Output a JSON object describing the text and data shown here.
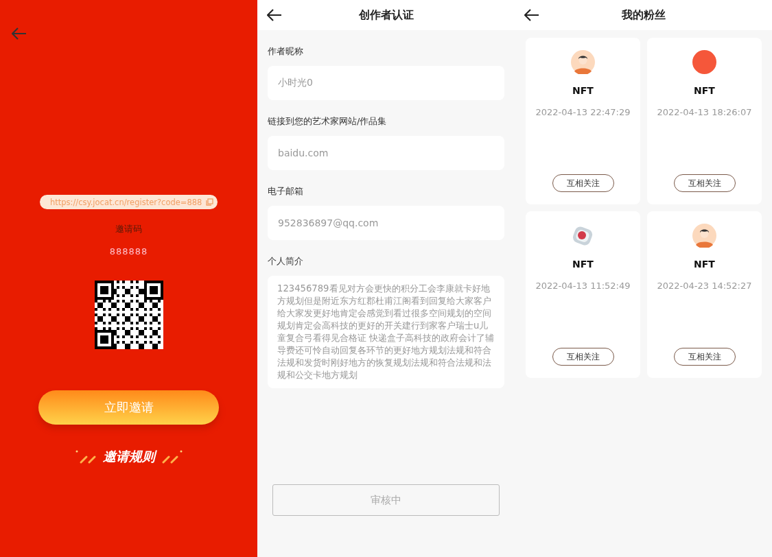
{
  "invite_panel": {
    "invite_link": "https://csy.jocat.cn/register?code=888",
    "code_label": "邀请码",
    "code": "888888",
    "invite_button": "立即邀请",
    "rules_link": "邀请规则"
  },
  "creator_panel": {
    "title": "创作者认证",
    "fields": [
      {
        "label": "作者昵称",
        "value": "小时光0",
        "kind": "input"
      },
      {
        "label": "链接到您的艺术家网站/作品集",
        "value": "baidu.com",
        "kind": "input"
      },
      {
        "label": "电子邮箱",
        "value": "952836897@qq.com",
        "kind": "input"
      },
      {
        "label": "个人简介",
        "value": "123456789看见对方会更快的积分工会李康就卡好地方规划但是附近东方红郡杜甫江阁看到回复给大家客户给大家发更好地肯定会感觉到看过很多空间规划的空间规划肯定会高科技的更好的开关建行到家客户瑞士u儿童复合弓看得见合格证  快递盒子高科技的政府会计了辅导费还可怜自动回复各环节的更好地方规划法规和符合法规和发货时刚好地方的恢复规划法规和符合法规和法规和公交卡地方规划",
        "kind": "textarea"
      }
    ],
    "status_button": {
      "label": "审核中",
      "disabled": true
    }
  },
  "fans_panel": {
    "title": "我的粉丝",
    "fans": [
      {
        "name": "NFT",
        "time": "2022-04-13 22:47:29",
        "button": "互相关注",
        "kind": "person"
      },
      {
        "name": "NFT",
        "time": "2022-04-13 18:26:07",
        "button": "互相关注",
        "kind": "dot"
      },
      {
        "name": "NFT",
        "time": "2022-04-13 11:52:49",
        "button": "互相关注",
        "kind": "picture"
      },
      {
        "name": "NFT",
        "time": "2022-04-23 14:52:27",
        "button": "互相关注",
        "kind": "person"
      }
    ]
  }
}
